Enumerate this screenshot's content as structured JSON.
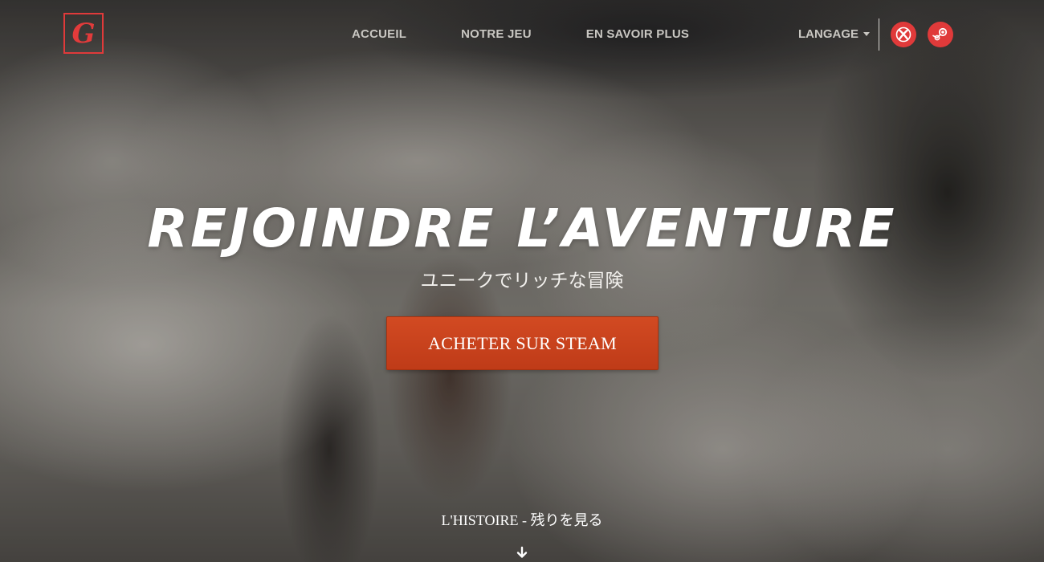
{
  "nav": {
    "logo_letter": "G",
    "links": [
      "ACCUEIL",
      "NOTRE JEU",
      "EN SAVOIR PLUS"
    ],
    "language_label": "LANGAGE",
    "platform_icons": [
      "xbox-icon",
      "steam-icon"
    ]
  },
  "hero": {
    "headline": "REJOINDRE L’AVENTURE",
    "subtitle": "ユニークでリッチな冒険",
    "cta_label": "ACHETER SUR STEAM",
    "story_link": "L'HISTOIRE - 残りを見る"
  },
  "colors": {
    "accent": "#e03a3a",
    "cta": "#c8411c"
  }
}
